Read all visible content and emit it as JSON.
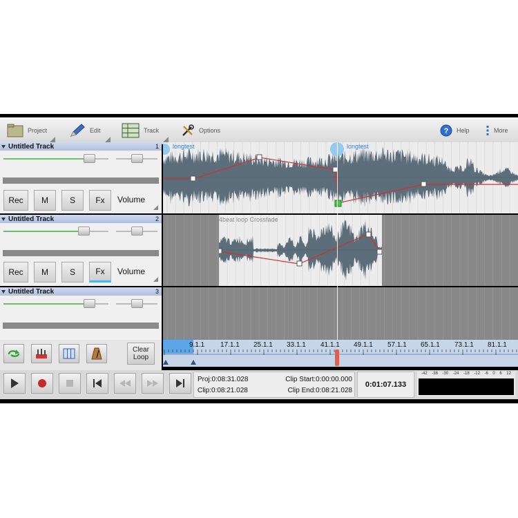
{
  "toolbar": {
    "project": "Project",
    "edit": "Edit",
    "track": "Track",
    "options": "Options",
    "help": "Help",
    "more": "More"
  },
  "tracks": [
    {
      "name": "Untitled Track",
      "number": "1",
      "rec": "Rec",
      "mute": "M",
      "solo": "S",
      "fx": "Fx",
      "param": "Volume"
    },
    {
      "name": "Untitled Track",
      "number": "2",
      "rec": "Rec",
      "mute": "M",
      "solo": "S",
      "fx": "Fx",
      "param": "Volume"
    },
    {
      "name": "Untitled Track",
      "number": "3"
    }
  ],
  "clips": {
    "track1_a": "longtest",
    "track1_b": "longtest",
    "track2": "4beat loop Crossfade"
  },
  "loop": {
    "clear_line1": "Clear",
    "clear_line2": "Loop"
  },
  "ruler_labels": [
    "9.1.1",
    "17.1.1",
    "25.1.1",
    "33.1.1",
    "41.1.1",
    "49.1.1",
    "57.1.1",
    "65.1.1",
    "73.1.1",
    "81.1.1"
  ],
  "info": {
    "proj": "Proj:0:08:31.028",
    "clip": "Clip:0:08:21.028",
    "clip_start": "Clip Start:0:00:00.000",
    "clip_end": "Clip End:0:08:21.028",
    "time": "0:01:07.133"
  },
  "meter_scale": [
    "-42",
    "-36",
    "-30",
    "-24",
    "-18",
    "-12",
    "-6",
    "0",
    "6",
    "12"
  ],
  "colors": {
    "accent": "#3a8fd8",
    "waveform": "#5c6e7a",
    "envelope": "#d03030",
    "playhead": "#e0604a"
  }
}
